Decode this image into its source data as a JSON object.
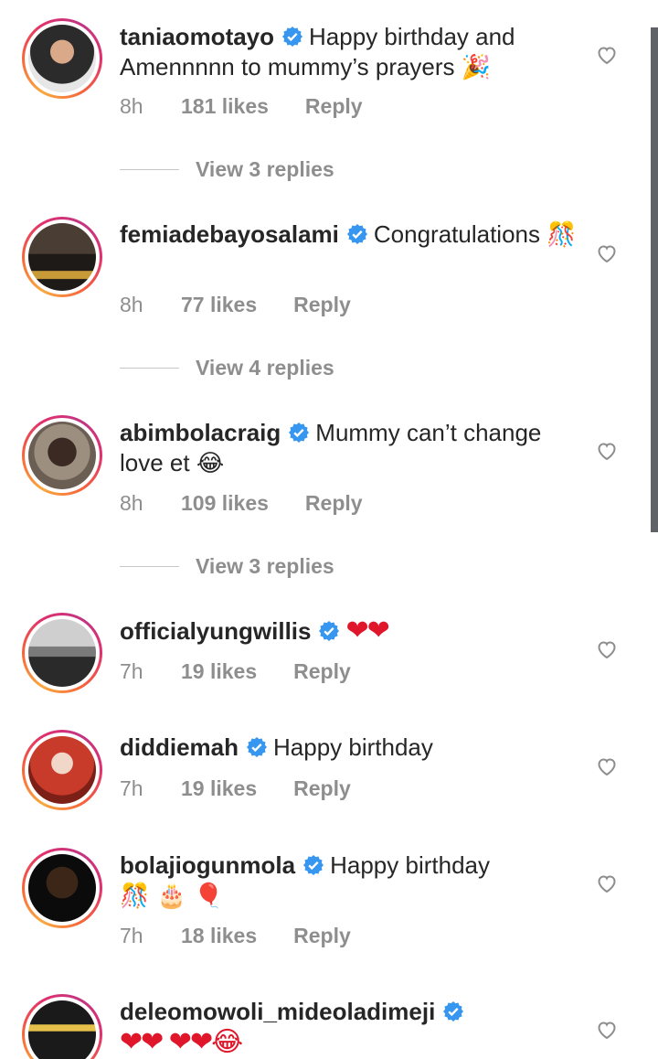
{
  "comments": [
    {
      "username": "taniaomotayo",
      "text": "Happy birthday and Amennnnn to mummy’s prayers",
      "emoji": "🎉",
      "time": "8h",
      "likes": "181 likes",
      "reply": "Reply",
      "view_replies": "View 3 replies",
      "avatar_colors": [
        "#2b2b2b",
        "#d9a98a"
      ]
    },
    {
      "username": "femiadebayosalami",
      "text": "Congratulations",
      "emoji": "🎊",
      "time": "8h",
      "likes": "77 likes",
      "reply": "Reply",
      "view_replies": "View 4 replies",
      "avatar_colors": [
        "#1d1a17",
        "#c89b38"
      ]
    },
    {
      "username": "abimbolacraig",
      "text": "Mummy can’t change love et",
      "emoji": "😂",
      "time": "8h",
      "likes": "109 likes",
      "reply": "Reply",
      "view_replies": "View 3 replies",
      "avatar_colors": [
        "#9c8f80",
        "#3a2a23"
      ]
    },
    {
      "username": "officialyungwillis",
      "text": "",
      "emoji": "❤❤",
      "time": "7h",
      "likes": "19 likes",
      "reply": "Reply",
      "avatar_colors": [
        "#cfcfcf",
        "#2a2a2a"
      ]
    },
    {
      "username": "diddiemah",
      "text": "Happy birthday",
      "emoji": "",
      "time": "7h",
      "likes": "19 likes",
      "reply": "Reply",
      "avatar_colors": [
        "#c83a2a",
        "#f0d7c7"
      ]
    },
    {
      "username": "bolajiogunmola",
      "text": "Happy birthday",
      "emoji": "🎊 🎂 🎈",
      "time": "7h",
      "likes": "18 likes",
      "reply": "Reply",
      "avatar_colors": [
        "#3b2618",
        "#0b0b0b"
      ]
    },
    {
      "username": "deleomowoli_mideoladimeji",
      "text": "",
      "emoji": "❤❤ ❤❤😂",
      "avatar_colors": [
        "#1a1a1a",
        "#e5c04a"
      ]
    }
  ],
  "colors": {
    "verified": "#3797f0",
    "meta": "#8e8e8e",
    "heart": "#e0162b"
  },
  "icons": {
    "verified": "verified-badge-icon",
    "like": "heart-outline-icon"
  }
}
